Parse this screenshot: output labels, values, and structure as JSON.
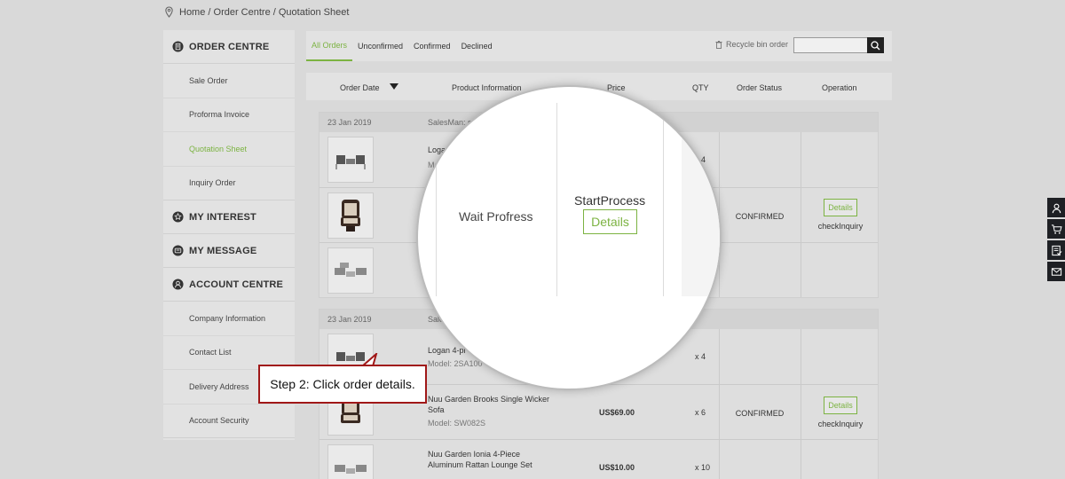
{
  "breadcrumb": {
    "text": "Home / Order Centre / Quotation Sheet"
  },
  "sidebar": {
    "order_centre": "ORDER CENTRE",
    "order_items": [
      "Sale Order",
      "Proforma Invoice",
      "Quotation Sheet",
      "Inquiry Order"
    ],
    "my_interest": "MY INTEREST",
    "my_message": "MY MESSAGE",
    "account_centre": "ACCOUNT CENTRE",
    "account_items": [
      "Company Information",
      "Contact List",
      "Delivery Address",
      "Account Security"
    ]
  },
  "tabs": [
    "All Orders",
    "Unconfirmed",
    "Confirmed",
    "Declined"
  ],
  "recycle": "Recycle bin order",
  "table": {
    "headers": [
      "Order Date",
      "Product Information",
      "Price",
      "QTY",
      "Order Status",
      "Operation"
    ]
  },
  "orders": [
    {
      "date": "23 Jan 2019",
      "salesman": "SalesMan: s",
      "rows": [
        {
          "name": "Logan",
          "model": "Mo",
          "price": "",
          "qty": "4"
        },
        {
          "name": "",
          "model": "",
          "price": "",
          "qty": ""
        },
        {
          "name": "",
          "model": "",
          "price": "",
          "qty": ""
        }
      ],
      "status": "CONFIRMED",
      "details": "Details",
      "check": "checkInquiry"
    },
    {
      "date": "23 Jan 2019",
      "salesman": "Sale",
      "rows": [
        {
          "name": "Logan 4-pi",
          "model": "Model: 2SA100",
          "price": "",
          "qty": "x 4"
        },
        {
          "name": "Nuu Garden Brooks Single Wicker Sofa",
          "model": "Model: SW082S",
          "price": "US$69.00",
          "qty": "x 6"
        },
        {
          "name": "Nuu Garden Ionia 4-Piece Aluminum Rattan Lounge Set",
          "model": "",
          "price": "US$10.00",
          "qty": "x 10"
        }
      ],
      "status": "CONFIRMED",
      "details": "Details",
      "check": "checkInquiry"
    }
  ],
  "magnifier": {
    "wait": "Wait Profress",
    "start": "StartProcess",
    "details": "Details"
  },
  "callout": {
    "text": "Step 2: Click order details."
  },
  "colors": {
    "accent": "#7cb342",
    "callout_border": "#a01818"
  }
}
